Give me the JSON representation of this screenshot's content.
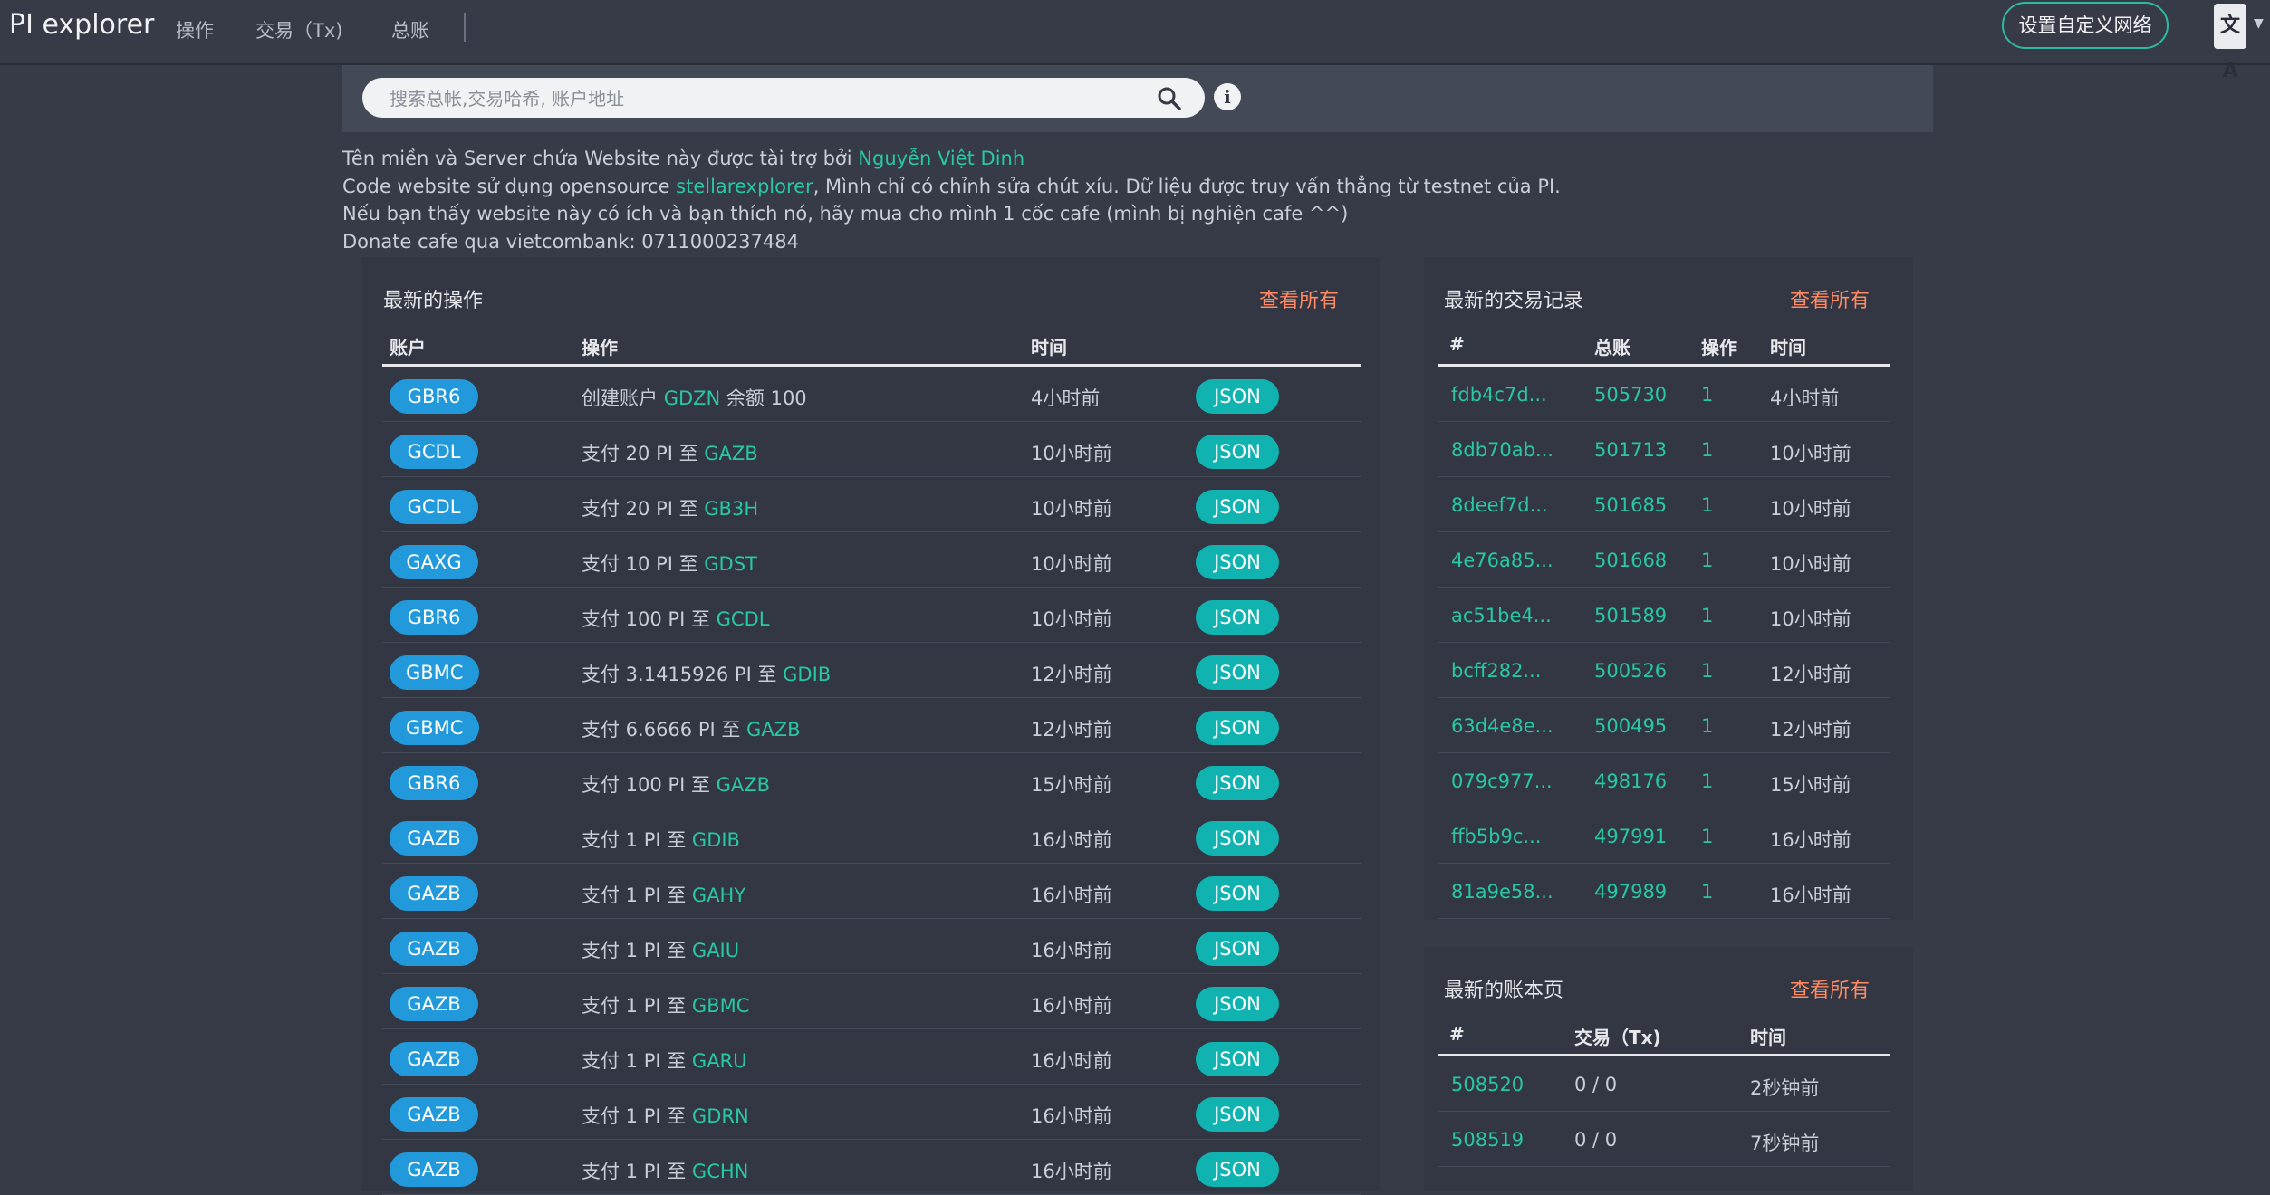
{
  "nav": {
    "brand": "PI explorer",
    "items": [
      "操作",
      "交易（Tx)",
      "总账"
    ],
    "network_button": "设置自定义网络",
    "language_icon": "文A"
  },
  "search": {
    "placeholder": "搜索总帐,交易哈希, 账户地址"
  },
  "notice": {
    "line1_text": "Tên miền và Server chứa Website này được tài trợ bởi ",
    "line1_link": "Nguyễn Việt Dinh",
    "line2_pre": "Code website sử dụng opensource ",
    "line2_link": "stellarexplorer",
    "line2_post": ", Mình chỉ có chỉnh sửa chút xíu. Dữ liệu được truy vấn thẳng từ testnet của PI.",
    "line3": "Nếu bạn thấy website này có ích và bạn thích nó, hãy mua cho mình 1 cốc cafe (mình bị nghiện cafe ^^)",
    "line4": "Donate cafe qua vietcombank: 0711000237484"
  },
  "operations": {
    "title": "最新的操作",
    "view_all": "查看所有",
    "headers": [
      "账户",
      "操作",
      "时间"
    ],
    "json_label": "JSON",
    "rows": [
      {
        "account": "GBR6",
        "pre": "创建账户 ",
        "link": "GDZN",
        "post": " 余额 100",
        "time": "4小时前"
      },
      {
        "account": "GCDL",
        "pre": "支付 20 PI 至 ",
        "link": "GAZB",
        "post": "",
        "time": "10小时前"
      },
      {
        "account": "GCDL",
        "pre": "支付 20 PI 至 ",
        "link": "GB3H",
        "post": "",
        "time": "10小时前"
      },
      {
        "account": "GAXG",
        "pre": "支付 10 PI 至 ",
        "link": "GDST",
        "post": "",
        "time": "10小时前"
      },
      {
        "account": "GBR6",
        "pre": "支付 100 PI 至 ",
        "link": "GCDL",
        "post": "",
        "time": "10小时前"
      },
      {
        "account": "GBMC",
        "pre": "支付 3.1415926 PI 至 ",
        "link": "GDIB",
        "post": "",
        "time": "12小时前"
      },
      {
        "account": "GBMC",
        "pre": "支付 6.6666 PI 至 ",
        "link": "GAZB",
        "post": "",
        "time": "12小时前"
      },
      {
        "account": "GBR6",
        "pre": "支付 100 PI 至 ",
        "link": "GAZB",
        "post": "",
        "time": "15小时前"
      },
      {
        "account": "GAZB",
        "pre": "支付 1 PI 至 ",
        "link": "GDIB",
        "post": "",
        "time": "16小时前"
      },
      {
        "account": "GAZB",
        "pre": "支付 1 PI 至 ",
        "link": "GAHY",
        "post": "",
        "time": "16小时前"
      },
      {
        "account": "GAZB",
        "pre": "支付 1 PI 至 ",
        "link": "GAIU",
        "post": "",
        "time": "16小时前"
      },
      {
        "account": "GAZB",
        "pre": "支付 1 PI 至 ",
        "link": "GBMC",
        "post": "",
        "time": "16小时前"
      },
      {
        "account": "GAZB",
        "pre": "支付 1 PI 至 ",
        "link": "GARU",
        "post": "",
        "time": "16小时前"
      },
      {
        "account": "GAZB",
        "pre": "支付 1 PI 至 ",
        "link": "GDRN",
        "post": "",
        "time": "16小时前"
      },
      {
        "account": "GAZB",
        "pre": "支付 1 PI 至 ",
        "link": "GCHN",
        "post": "",
        "time": "16小时前"
      }
    ]
  },
  "transactions": {
    "title": "最新的交易记录",
    "view_all": "查看所有",
    "headers": [
      "#",
      "总账",
      "操作",
      "时间"
    ],
    "rows": [
      {
        "hash": "fdb4c7d...",
        "ledger": "505730",
        "ops": "1",
        "time": "4小时前"
      },
      {
        "hash": "8db70ab...",
        "ledger": "501713",
        "ops": "1",
        "time": "10小时前"
      },
      {
        "hash": "8deef7d...",
        "ledger": "501685",
        "ops": "1",
        "time": "10小时前"
      },
      {
        "hash": "4e76a85...",
        "ledger": "501668",
        "ops": "1",
        "time": "10小时前"
      },
      {
        "hash": "ac51be4...",
        "ledger": "501589",
        "ops": "1",
        "time": "10小时前"
      },
      {
        "hash": "bcff282...",
        "ledger": "500526",
        "ops": "1",
        "time": "12小时前"
      },
      {
        "hash": "63d4e8e...",
        "ledger": "500495",
        "ops": "1",
        "time": "12小时前"
      },
      {
        "hash": "079c977...",
        "ledger": "498176",
        "ops": "1",
        "time": "15小时前"
      },
      {
        "hash": "ffb5b9c...",
        "ledger": "497991",
        "ops": "1",
        "time": "16小时前"
      },
      {
        "hash": "81a9e58...",
        "ledger": "497989",
        "ops": "1",
        "time": "16小时前"
      }
    ]
  },
  "ledgers": {
    "title": "最新的账本页",
    "view_all": "查看所有",
    "headers": [
      "#",
      "交易（Tx)",
      "时间"
    ],
    "rows": [
      {
        "ledger": "508520",
        "tx": "0 / 0",
        "time": "2秒钟前"
      },
      {
        "ledger": "508519",
        "tx": "0 / 0",
        "time": "7秒钟前"
      }
    ]
  },
  "colors": {
    "background": "#363b47",
    "panel": "#323743",
    "accent_link": "#27c8a2",
    "view_all": "#ff8a63",
    "pill": "#2299db",
    "json_button": "#10b3b0"
  }
}
